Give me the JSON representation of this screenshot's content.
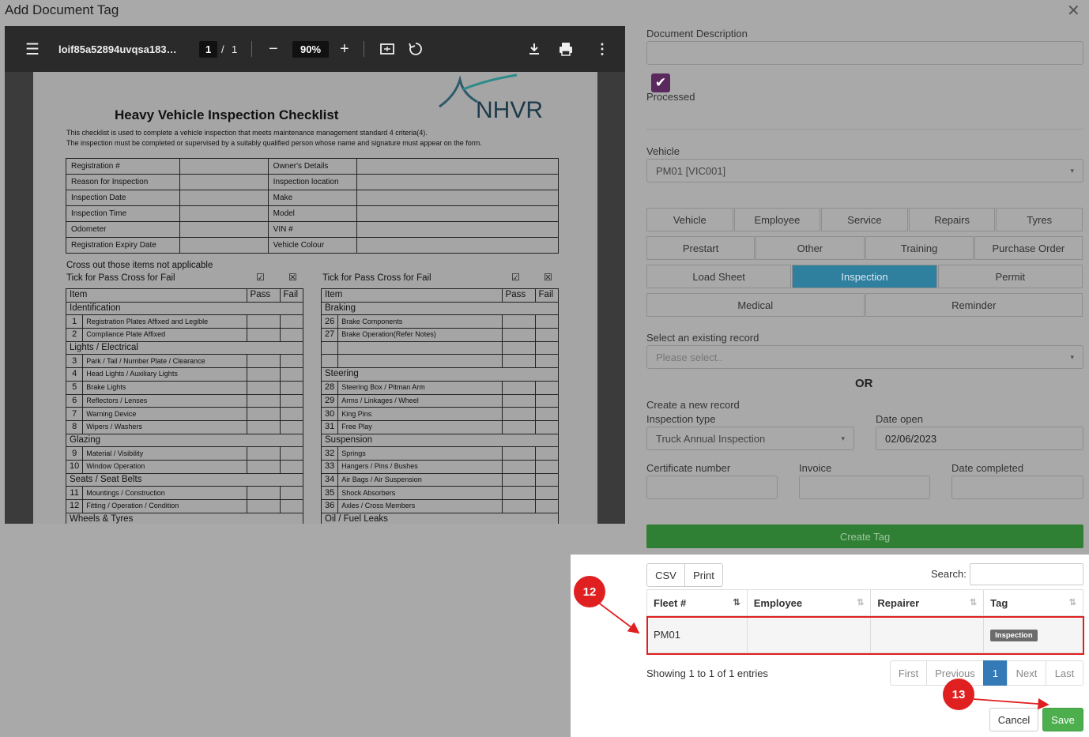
{
  "dialog": {
    "title": "Add Document Tag"
  },
  "viewer": {
    "filename": "loif85a52894uvqsa183…",
    "page_current": "1",
    "page_sep": "/",
    "page_total": "1",
    "zoom": "90%"
  },
  "doc": {
    "title": "Heavy Vehicle Inspection Checklist",
    "logo_text": "NHVR",
    "intro1": "This checklist is used to complete a vehicle inspection that meets maintenance management standard 4 criteria(4).",
    "intro2": "The inspection must be completed or supervised by a suitably qualified person whose name and signature must appear on the form.",
    "info_rows": [
      [
        "Registration #",
        "",
        "Owner's Details",
        ""
      ],
      [
        "Reason for Inspection",
        "",
        "Inspection location",
        ""
      ],
      [
        "Inspection Date",
        "",
        "Make",
        ""
      ],
      [
        "Inspection Time",
        "",
        "Model",
        ""
      ],
      [
        "Odometer",
        "",
        "VIN #",
        ""
      ],
      [
        "Registration Expiry Date",
        "",
        "Vehicle Colour",
        ""
      ]
    ],
    "cross_out": "Cross out those items not applicable",
    "tick_left": "Tick for Pass Cross for Fail",
    "tick_right": "Tick for Pass Cross for Fail",
    "pass_sym": "☑",
    "fail_sym": "☒",
    "col_item": "Item",
    "col_pass": "Pass",
    "col_fail": "Fail",
    "left_rows": [
      {
        "sec": "Identification"
      },
      {
        "n": "1",
        "t": "Registration Plates Affixed and Legible"
      },
      {
        "n": "2",
        "t": "Compliance Plate Affixed"
      },
      {
        "sec": "Lights / Electrical"
      },
      {
        "n": "3",
        "t": "Park / Tail / Number Plate / Clearance"
      },
      {
        "n": "4",
        "t": "Head Lights / Auxiliary Lights"
      },
      {
        "n": "5",
        "t": "Brake Lights"
      },
      {
        "n": "6",
        "t": "Reflectors / Lenses"
      },
      {
        "n": "7",
        "t": "Warning Device"
      },
      {
        "n": "8",
        "t": "Wipers / Washers"
      },
      {
        "sec": "Glazing"
      },
      {
        "n": "9",
        "t": "Material / Visibility"
      },
      {
        "n": "10",
        "t": "Window Operation"
      },
      {
        "sec": "Seats / Seat Belts"
      },
      {
        "n": "11",
        "t": "Mountings / Construction"
      },
      {
        "n": "12",
        "t": "Fitting / Operation / Condition"
      },
      {
        "sec": "Wheels & Tyres"
      }
    ],
    "right_rows": [
      {
        "sec": "Braking"
      },
      {
        "n": "26",
        "t": "Brake Components"
      },
      {
        "n": "27",
        "t": "Brake Operation(Refer Notes)"
      },
      {
        "n": "",
        "t": ""
      },
      {
        "n": "",
        "t": ""
      },
      {
        "sec": "Steering"
      },
      {
        "n": "28",
        "t": "Steering Box / Pitman Arm"
      },
      {
        "n": "29",
        "t": "Arms / Linkages / Wheel"
      },
      {
        "n": "30",
        "t": "King Pins"
      },
      {
        "n": "31",
        "t": "Free Play"
      },
      {
        "sec": "Suspension"
      },
      {
        "n": "32",
        "t": "Springs"
      },
      {
        "n": "33",
        "t": "Hangers / Pins / Bushes"
      },
      {
        "n": "34",
        "t": "Air Bags / Air Suspension"
      },
      {
        "n": "35",
        "t": "Shock Absorbers"
      },
      {
        "n": "36",
        "t": "Axles / Cross Members"
      },
      {
        "sec": "Oil / Fuel Leaks"
      }
    ]
  },
  "form": {
    "desc_label": "Document Description",
    "desc_value": "",
    "processed_label": "Processed",
    "processed_checked": true,
    "vehicle_label": "Vehicle",
    "vehicle_value": "PM01 [VIC001]",
    "tag_rows": [
      [
        "Vehicle",
        "Employee",
        "Service",
        "Repairs",
        "Tyres"
      ],
      [
        "Prestart",
        "Other",
        "Training",
        "Purchase Order"
      ],
      [
        "Load Sheet",
        "Inspection",
        "Permit"
      ],
      [
        "Medical",
        "Reminder"
      ]
    ],
    "active_tag": "Inspection",
    "existing_label": "Select an existing record",
    "existing_placeholder": "Please select..",
    "or": "OR",
    "create_label": "Create a new record",
    "insp_type_label": "Inspection type",
    "insp_type_value": "Truck Annual Inspection",
    "date_open_label": "Date open",
    "date_open_value": "02/06/2023",
    "cert_label": "Certificate number",
    "invoice_label": "Invoice",
    "date_completed_label": "Date completed",
    "create_btn": "Create Tag"
  },
  "table": {
    "csv": "CSV",
    "print": "Print",
    "search_label": "Search:",
    "search_value": "",
    "headers": [
      "Fleet #",
      "Employee",
      "Repairer",
      "Tag"
    ],
    "rows": [
      {
        "fleet": "PM01",
        "employee": "",
        "repairer": "",
        "tag": "Inspection"
      }
    ],
    "info": "Showing 1 to 1 of 1 entries",
    "pages": {
      "first": "First",
      "prev": "Previous",
      "cur": "1",
      "next": "Next",
      "last": "Last"
    }
  },
  "actions": {
    "cancel": "Cancel",
    "save": "Save"
  },
  "markers": [
    "12",
    "13"
  ],
  "colors": {
    "active_tag": "#2f7f9f",
    "create": "#2f7f35",
    "save": "#4cae4c",
    "marker": "#e02020",
    "page_cur": "#337ab7"
  }
}
